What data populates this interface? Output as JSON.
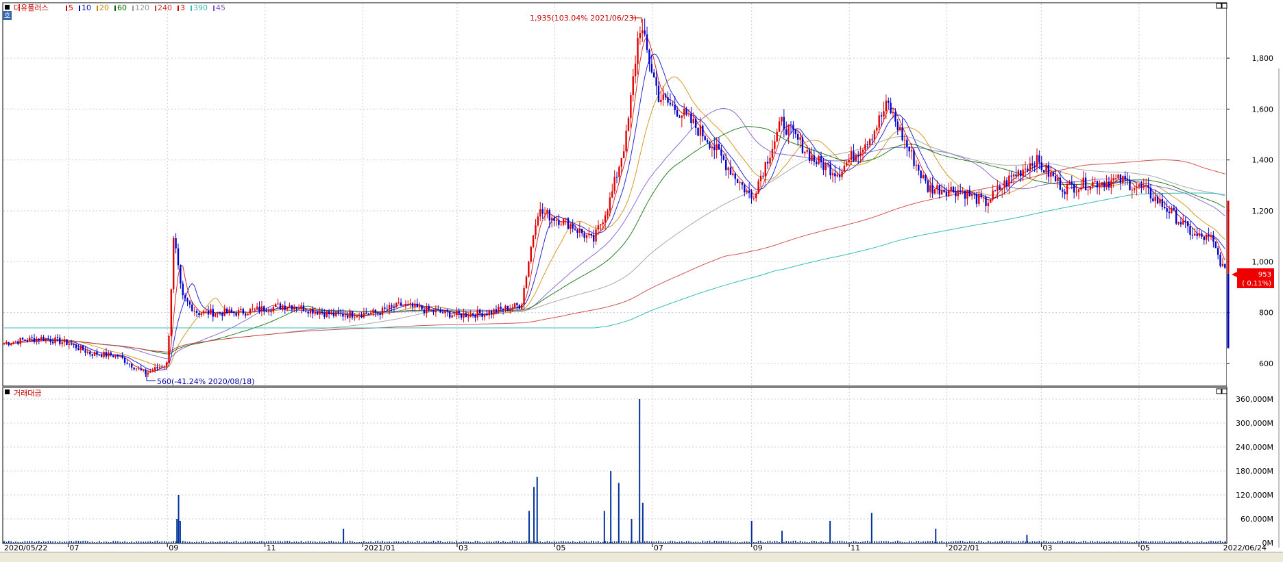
{
  "panels": {
    "price": {
      "stock_name": "대유플러스",
      "ma_legend": [
        {
          "label": "5",
          "color": "#cc0000"
        },
        {
          "label": "10",
          "color": "#0000cc"
        },
        {
          "label": "20",
          "color": "#cc8800"
        },
        {
          "label": "60",
          "color": "#006600"
        },
        {
          "label": "120",
          "color": "#999999"
        },
        {
          "label": "240",
          "color": "#cc3333"
        },
        {
          "label": "3",
          "color": "#cc0000"
        },
        {
          "label": "390",
          "color": "#33bbbb"
        },
        {
          "label": "45",
          "color": "#7755cc"
        }
      ],
      "corner_badge": "호",
      "high_annotation": "1,935(103.04% 2021/06/23)",
      "low_annotation": "560(-41.24% 2020/08/18)",
      "current_price": "953",
      "current_change": "( 0.11%)",
      "y_ticks": [
        "1,800",
        "1,600",
        "1,400",
        "1,200",
        "1,000",
        "800",
        "600"
      ]
    },
    "volume": {
      "title": "거래대금",
      "y_ticks": [
        "360,000M",
        "300,000M",
        "240,000M",
        "180,000M",
        "120,000M",
        "60,000M",
        "0M"
      ]
    }
  },
  "x_axis": {
    "start_label": "2020/05/22",
    "end_label": "2022/06/24",
    "ticks": [
      "07",
      "09",
      "11",
      "2021/01",
      "03",
      "05",
      "07",
      "09",
      "11",
      "2022/01",
      "03",
      "05"
    ]
  },
  "colors": {
    "up": "#e00000",
    "down": "#0000cc",
    "ma5": "#cc0000",
    "ma10": "#0000cc",
    "ma20": "#cc8800",
    "ma60": "#006600",
    "ma120": "#999999",
    "ma240": "#cc3333",
    "ma390": "#33bbbb",
    "ma45": "#7755cc",
    "volume": "#003399",
    "price_badge": "#ee0000"
  },
  "chart_data": {
    "type": "line",
    "title": "",
    "x_range": [
      "2020/05/22",
      "2022/06/24"
    ],
    "ylim": [
      560,
      1935
    ],
    "series": [
      {
        "name": "대유플러스",
        "x": [
          "2020/05/22",
          "2020/06/01",
          "2020/06/15",
          "2020/07/01",
          "2020/07/15",
          "2020/08/01",
          "2020/08/18",
          "2020/09/01",
          "2020/09/05",
          "2020/09/10",
          "2020/09/20",
          "2020/10/15",
          "2020/11/15",
          "2020/12/15",
          "2021/01/10",
          "2021/01/25",
          "2021/02/10",
          "2021/03/01",
          "2021/03/20",
          "2021/04/10",
          "2021/04/20",
          "2021/05/10",
          "2021/05/25",
          "2021/06/05",
          "2021/06/15",
          "2021/06/23",
          "2021/07/05",
          "2021/07/20",
          "2021/08/05",
          "2021/08/20",
          "2021/09/01",
          "2021/09/20",
          "2021/10/10",
          "2021/10/25",
          "2021/11/15",
          "2021/11/25",
          "2021/12/05",
          "2021/12/20",
          "2022/01/10",
          "2022/01/25",
          "2022/02/10",
          "2022/02/25",
          "2022/03/15",
          "2022/04/01",
          "2022/04/20",
          "2022/05/05",
          "2022/05/20",
          "2022/06/05",
          "2022/06/15",
          "2022/06/24"
        ],
        "values": [
          680,
          690,
          700,
          680,
          640,
          630,
          560,
          600,
          1100,
          860,
          800,
          800,
          830,
          790,
          800,
          830,
          810,
          790,
          800,
          830,
          1200,
          1150,
          1080,
          1250,
          1500,
          1935,
          1650,
          1580,
          1480,
          1350,
          1250,
          1550,
          1400,
          1350,
          1500,
          1620,
          1480,
          1290,
          1280,
          1230,
          1330,
          1400,
          1290,
          1310,
          1320,
          1280,
          1200,
          1100,
          1090,
          953
        ]
      },
      {
        "name": "거래대금",
        "x": [
          "2020/05/22",
          "2020/09/07",
          "2020/09/08",
          "2020/09/09",
          "2020/12/20",
          "2021/04/15",
          "2021/04/18",
          "2021/04/20",
          "2021/06/01",
          "2021/06/05",
          "2021/06/10",
          "2021/06/18",
          "2021/06/23",
          "2021/06/25",
          "2021/09/01",
          "2021/09/20",
          "2021/10/20",
          "2021/11/15",
          "2021/12/25",
          "2022/02/20",
          "2022/06/24"
        ],
        "values": [
          3000,
          60000,
          120000,
          55000,
          35000,
          80000,
          140000,
          165000,
          80000,
          180000,
          150000,
          60000,
          360000,
          100000,
          55000,
          30000,
          55000,
          75000,
          35000,
          20000,
          3000
        ]
      }
    ]
  }
}
